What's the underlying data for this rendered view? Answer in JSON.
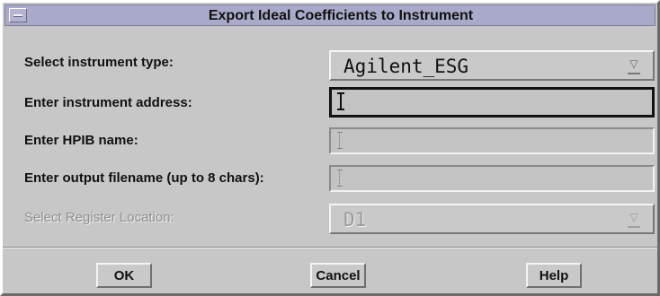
{
  "dialog": {
    "title": "Export Ideal Coefficients to Instrument"
  },
  "rows": {
    "instrument_type": {
      "label": "Select instrument type:",
      "value": "Agilent_ESG"
    },
    "instrument_address": {
      "label": "Enter instrument address:",
      "value": ""
    },
    "hpib_name": {
      "label": "Enter HPIB name:",
      "value": ""
    },
    "output_filename": {
      "label": "Enter output filename (up to 8 chars):",
      "value": ""
    },
    "register_location": {
      "label": "Select Register Location:",
      "value": "D1",
      "enabled": false
    }
  },
  "buttons": {
    "ok": "OK",
    "cancel": "Cancel",
    "help": "Help"
  },
  "icons": {
    "window_menu": "window-menu-icon",
    "option_caret": "option-menu-indicator-icon",
    "text_cursor": "ibeam-cursor-icon"
  },
  "colors": {
    "background": "#c7c7c7",
    "titlebar": "#a9a9c9",
    "disabled_text": "#8f8f8f"
  }
}
